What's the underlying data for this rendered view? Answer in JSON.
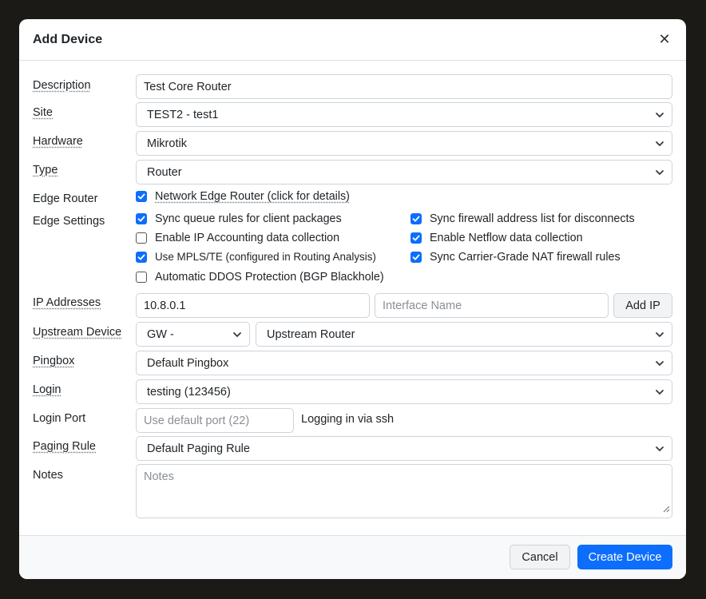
{
  "modal": {
    "title": "Add Device",
    "close_glyph": "✕"
  },
  "labels": {
    "description": "Description",
    "site": "Site",
    "hardware": "Hardware",
    "type": "Type",
    "edge_router": "Edge Router",
    "edge_settings": "Edge Settings",
    "ip_addresses": "IP Addresses",
    "upstream_device": "Upstream Device",
    "pingbox": "Pingbox",
    "login": "Login",
    "login_port": "Login Port",
    "paging_rule": "Paging Rule",
    "notes": "Notes"
  },
  "fields": {
    "description": "Test Core Router",
    "site": "TEST2 - test1",
    "hardware": "Mikrotik",
    "type": "Router",
    "ip_address": "10.8.0.1",
    "interface_placeholder": "Interface Name",
    "add_ip_label": "Add IP",
    "upstream_gw": "GW -",
    "upstream_router": "Upstream Router",
    "pingbox": "Default Pingbox",
    "login": "testing (123456)",
    "login_port_placeholder": "Use default port (22)",
    "login_port_note": "Logging in via ssh",
    "paging_rule": "Default Paging Rule",
    "notes_placeholder": "Notes"
  },
  "edge_router": {
    "label": "Network Edge Router (click for details)",
    "checked": true
  },
  "edge_settings": [
    {
      "label": "Sync queue rules for client packages",
      "checked": true
    },
    {
      "label": "Sync firewall address list for disconnects",
      "checked": true
    },
    {
      "label": "Enable IP Accounting data collection",
      "checked": false
    },
    {
      "label": "Enable Netflow data collection",
      "checked": true
    },
    {
      "label": "Use MPLS/TE (configured in Routing Analysis)",
      "checked": true
    },
    {
      "label": "Sync Carrier-Grade NAT firewall rules",
      "checked": true
    },
    {
      "label": "Automatic DDOS Protection (BGP Blackhole)",
      "checked": false
    }
  ],
  "footer": {
    "cancel_label": "Cancel",
    "create_label": "Create Device"
  },
  "colors": {
    "primary": "#0d6efd",
    "backdrop": "#1c1a17"
  }
}
